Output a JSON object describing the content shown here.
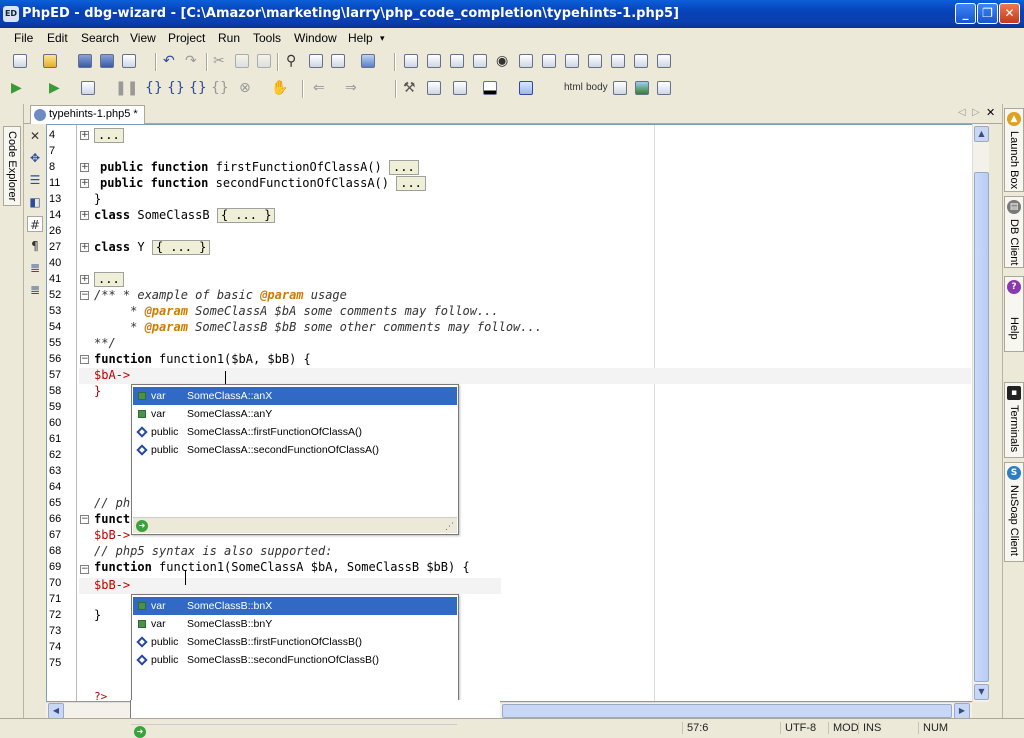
{
  "window": {
    "title": "PhpED - dbg-wizard - [C:\\Amazor\\marketing\\larry\\php_code_completion\\typehints-1.php5]",
    "app_icon": "ED"
  },
  "menu": [
    "File",
    "Edit",
    "Search",
    "View",
    "Project",
    "Run",
    "Tools",
    "Window",
    "Help"
  ],
  "toolbar_text": {
    "html": "html",
    "body": "body"
  },
  "left_panel": {
    "label": "Code Explorer"
  },
  "right_panels": [
    {
      "label": "Launch Box",
      "icon": "launch-icon"
    },
    {
      "label": "DB Client",
      "icon": "db-icon"
    },
    {
      "label": "Help",
      "icon": "help-icon"
    },
    {
      "label": "Terminals",
      "icon": "terminal-icon"
    },
    {
      "label": "NuSoap Client",
      "icon": "soap-icon"
    }
  ],
  "tab": {
    "label": "typehints-1.php5 *"
  },
  "gutter_lines": [
    "4",
    "7",
    "8",
    "11",
    "13",
    "14",
    "26",
    "27",
    "40",
    "41",
    "52",
    "53",
    "54",
    "55",
    "56",
    "57",
    "58",
    "59",
    "60",
    "61",
    "62",
    "63",
    "64",
    "65",
    "66",
    "67",
    "68",
    "69",
    "70",
    "71",
    "72",
    "73",
    "74",
    "75"
  ],
  "code": {
    "l4": "...",
    "l8_kw": "public function",
    "l8_name": "firstFunctionOfClassA()",
    "l8_box": "...",
    "l11_kw": "public function",
    "l11_name": "secondFunctionOfClassA()",
    "l11_box": "...",
    "l13": "}",
    "l14_kw": "class",
    "l14_name": "SomeClassB",
    "l14_box": "{ ... }",
    "l27_kw": "class",
    "l27_name": "Y",
    "l27_box": "{ ... }",
    "l41": "...",
    "l52_a": "/** * example of basic ",
    "l52_tag": "@param",
    "l52_b": " usage",
    "l53_pre": "     * ",
    "l53_tag": "@param",
    "l53_rest": " SomeClassA $bA some comments may follow...",
    "l54_pre": "     * ",
    "l54_tag": "@param",
    "l54_rest": " SomeClassB $bB some other comments may follow...",
    "l55": "**/",
    "l56_kw": "function",
    "l56_rest": " function1($bA, $bB) {",
    "l57": "$bA->",
    "l58": "}",
    "l65": "// ph",
    "l66_kw": "funct",
    "l67": "$bB->",
    "l68": "// php5 syntax is also supported:",
    "l69_kw": "function",
    "l69_rest": " function1(SomeClassA $bA, SomeClassB $bB) {",
    "l70": "$bB->",
    "l72": "}",
    "l_end": "?>"
  },
  "popup1": [
    {
      "kind": "var",
      "name": "SomeClassA::anX",
      "icon": "field",
      "selected": true
    },
    {
      "kind": "var",
      "name": "SomeClassA::anY",
      "icon": "field",
      "selected": false
    },
    {
      "kind": "public",
      "name": "SomeClassA::firstFunctionOfClassA()",
      "icon": "method",
      "selected": false
    },
    {
      "kind": "public",
      "name": "SomeClassA::secondFunctionOfClassA()",
      "icon": "method",
      "selected": false
    }
  ],
  "popup2": [
    {
      "kind": "var",
      "name": "SomeClassB::bnX",
      "icon": "field",
      "selected": true
    },
    {
      "kind": "var",
      "name": "SomeClassB::bnY",
      "icon": "field",
      "selected": false
    },
    {
      "kind": "public",
      "name": "SomeClassB::firstFunctionOfClassB()",
      "icon": "method",
      "selected": false
    },
    {
      "kind": "public",
      "name": "SomeClassB::secondFunctionOfClassB()",
      "icon": "method",
      "selected": false
    }
  ],
  "status": {
    "position": "57:6",
    "encoding": "UTF-8",
    "mod": "MOD",
    "ins": "INS",
    "num": "NUM"
  },
  "colors": {
    "titlebar": "#0842b8",
    "selection": "#316ac5",
    "param_tag": "#d07a00",
    "variable": "#c00000"
  }
}
